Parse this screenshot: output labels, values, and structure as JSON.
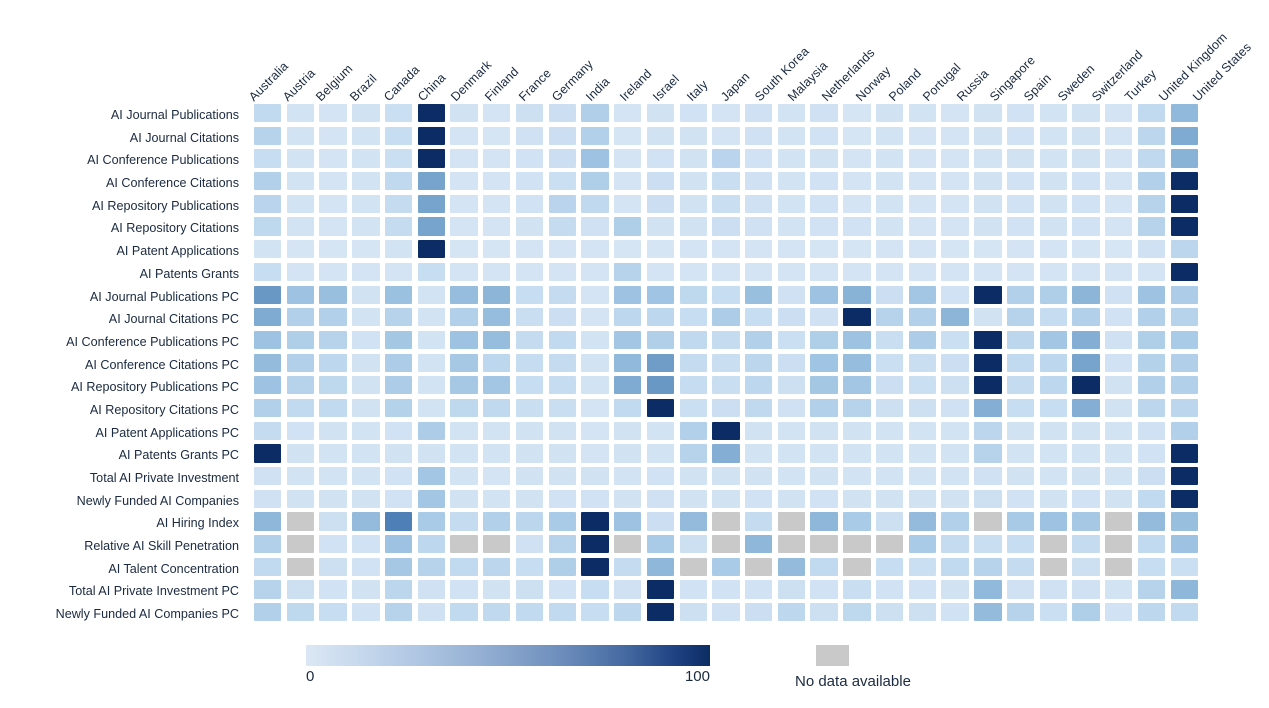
{
  "chart_data": {
    "type": "heatmap",
    "title": "",
    "xlabel": "",
    "ylabel": "",
    "legend": {
      "min_label": "0",
      "max_label": "100",
      "no_data_label": "No data available",
      "no_data_color": "#c9c9c9",
      "colormap_low": "#dbe7f4",
      "colormap_high": "#0d2c64",
      "vmin": 0,
      "vmax": 100
    },
    "categories": [
      "Australia",
      "Austria",
      "Belgium",
      "Brazil",
      "Canada",
      "China",
      "Denmark",
      "Finland",
      "France",
      "Germany",
      "India",
      "Ireland",
      "Israel",
      "Italy",
      "Japan",
      "South Korea",
      "Malaysia",
      "Netherlands",
      "Norway",
      "Poland",
      "Portugal",
      "Russia",
      "Singapore",
      "Spain",
      "Sweden",
      "Switzerland",
      "Turkey",
      "United Kingdom",
      "United States"
    ],
    "rows": [
      "AI Journal Publications",
      "AI Journal Citations",
      "AI Conference Publications",
      "AI Conference Citations",
      "AI Repository Publications",
      "AI Repository Citations",
      "AI Patent Applications",
      "AI Patents Grants",
      "AI Journal Publications PC",
      "AI Journal Citations PC",
      "AI Conference Publications PC",
      "AI Conference Citations PC",
      "AI Repository Publications PC",
      "AI Repository Citations PC",
      "AI Patent Applications PC",
      "AI Patents Grants PC",
      "Total AI Private Investment",
      "Newly Funded AI Companies",
      "AI Hiring Index",
      "Relative AI Skill Penetration",
      "AI Talent Concentration",
      "Total AI Private Investment PC",
      "Newly Funded AI Companies PC"
    ],
    "values": [
      [
        22,
        10,
        9,
        11,
        16,
        100,
        11,
        9,
        14,
        15,
        31,
        9,
        11,
        12,
        9,
        13,
        10,
        13,
        8,
        11,
        10,
        9,
        11,
        12,
        10,
        11,
        9,
        22,
        45
      ],
      [
        28,
        10,
        9,
        10,
        18,
        100,
        9,
        8,
        13,
        15,
        30,
        8,
        11,
        11,
        9,
        13,
        10,
        12,
        8,
        10,
        9,
        9,
        11,
        12,
        10,
        11,
        9,
        26,
        52
      ],
      [
        18,
        10,
        9,
        10,
        16,
        100,
        9,
        9,
        12,
        15,
        40,
        9,
        12,
        11,
        27,
        12,
        10,
        11,
        9,
        10,
        9,
        9,
        10,
        11,
        10,
        11,
        9,
        23,
        48
      ],
      [
        30,
        10,
        9,
        10,
        23,
        55,
        9,
        9,
        12,
        16,
        32,
        9,
        15,
        11,
        17,
        13,
        10,
        12,
        9,
        10,
        9,
        9,
        11,
        12,
        11,
        12,
        9,
        30,
        100
      ],
      [
        27,
        10,
        9,
        10,
        20,
        55,
        9,
        9,
        12,
        27,
        23,
        9,
        15,
        11,
        17,
        13,
        10,
        12,
        9,
        10,
        9,
        9,
        11,
        12,
        11,
        12,
        9,
        28,
        100
      ],
      [
        24,
        10,
        9,
        10,
        20,
        55,
        9,
        9,
        11,
        20,
        13,
        32,
        11,
        11,
        15,
        13,
        10,
        12,
        12,
        10,
        9,
        9,
        11,
        12,
        11,
        12,
        9,
        28,
        100
      ],
      [
        10,
        8,
        8,
        8,
        10,
        100,
        8,
        8,
        9,
        9,
        9,
        8,
        8,
        9,
        9,
        9,
        9,
        8,
        8,
        9,
        9,
        8,
        8,
        9,
        9,
        8,
        7,
        13,
        26
      ],
      [
        18,
        9,
        9,
        9,
        9,
        18,
        9,
        9,
        9,
        9,
        9,
        28,
        9,
        9,
        9,
        9,
        9,
        9,
        9,
        9,
        9,
        9,
        9,
        9,
        9,
        9,
        9,
        9,
        100
      ],
      [
        60,
        40,
        42,
        11,
        41,
        10,
        43,
        47,
        18,
        20,
        9,
        40,
        39,
        24,
        18,
        42,
        13,
        40,
        48,
        15,
        38,
        12,
        100,
        30,
        32,
        47,
        13,
        40,
        33
      ],
      [
        52,
        30,
        30,
        10,
        28,
        10,
        30,
        43,
        17,
        15,
        9,
        25,
        25,
        18,
        33,
        18,
        15,
        13,
        100,
        28,
        30,
        47,
        11,
        28,
        19,
        30,
        12,
        30,
        28
      ],
      [
        40,
        32,
        28,
        12,
        37,
        10,
        40,
        43,
        20,
        22,
        10,
        38,
        31,
        23,
        20,
        30,
        16,
        32,
        40,
        17,
        33,
        16,
        100,
        26,
        38,
        50,
        13,
        32,
        34
      ],
      [
        44,
        30,
        25,
        11,
        33,
        10,
        36,
        25,
        19,
        20,
        10,
        45,
        58,
        20,
        17,
        26,
        15,
        39,
        43,
        16,
        17,
        15,
        100,
        22,
        25,
        55,
        12,
        29,
        31
      ],
      [
        40,
        28,
        24,
        11,
        33,
        10,
        36,
        38,
        18,
        19,
        10,
        52,
        60,
        19,
        17,
        25,
        14,
        37,
        38,
        15,
        16,
        14,
        100,
        20,
        25,
        100,
        11,
        30,
        30
      ],
      [
        30,
        22,
        22,
        11,
        29,
        10,
        24,
        23,
        17,
        17,
        9,
        22,
        100,
        16,
        15,
        23,
        13,
        30,
        28,
        14,
        14,
        13,
        50,
        18,
        18,
        50,
        11,
        26,
        26
      ],
      [
        20,
        12,
        11,
        10,
        12,
        33,
        10,
        10,
        11,
        11,
        9,
        11,
        10,
        30,
        100,
        11,
        10,
        11,
        11,
        10,
        10,
        10,
        26,
        11,
        11,
        11,
        10,
        13,
        30
      ],
      [
        100,
        11,
        10,
        10,
        11,
        11,
        10,
        10,
        11,
        11,
        9,
        11,
        10,
        28,
        50,
        10,
        10,
        10,
        10,
        10,
        10,
        10,
        28,
        10,
        10,
        10,
        10,
        12,
        100
      ],
      [
        13,
        10,
        10,
        10,
        12,
        38,
        10,
        9,
        11,
        11,
        11,
        10,
        12,
        11,
        11,
        11,
        10,
        11,
        10,
        10,
        10,
        10,
        13,
        11,
        10,
        11,
        10,
        15,
        100
      ],
      [
        13,
        11,
        11,
        11,
        12,
        38,
        11,
        10,
        11,
        12,
        12,
        11,
        13,
        11,
        11,
        12,
        11,
        12,
        11,
        11,
        11,
        11,
        14,
        12,
        11,
        12,
        11,
        22,
        100
      ],
      [
        46,
        -1,
        14,
        44,
        70,
        34,
        20,
        30,
        26,
        34,
        100,
        40,
        15,
        44,
        -1,
        20,
        -1,
        46,
        34,
        14,
        44,
        30,
        -1,
        35,
        40,
        36,
        -1,
        44,
        42
      ],
      [
        30,
        -1,
        12,
        12,
        40,
        25,
        -1,
        -1,
        13,
        28,
        100,
        -1,
        34,
        14,
        -1,
        46,
        -1,
        -1,
        -1,
        -1,
        34,
        20,
        17,
        18,
        -1,
        20,
        -1,
        22,
        40
      ],
      [
        22,
        -1,
        14,
        12,
        36,
        28,
        22,
        26,
        18,
        32,
        100,
        20,
        46,
        -1,
        34,
        -1,
        44,
        22,
        -1,
        18,
        16,
        22,
        28,
        20,
        -1,
        14,
        -1,
        18,
        16
      ],
      [
        28,
        14,
        12,
        11,
        26,
        13,
        12,
        11,
        14,
        12,
        18,
        13,
        100,
        12,
        12,
        12,
        14,
        12,
        17,
        12,
        12,
        11,
        45,
        13,
        13,
        13,
        10,
        28,
        46
      ],
      [
        30,
        24,
        18,
        12,
        28,
        13,
        22,
        23,
        22,
        22,
        18,
        25,
        100,
        14,
        13,
        15,
        25,
        14,
        24,
        14,
        14,
        12,
        44,
        28,
        16,
        32,
        12,
        25,
        22
      ]
    ]
  }
}
